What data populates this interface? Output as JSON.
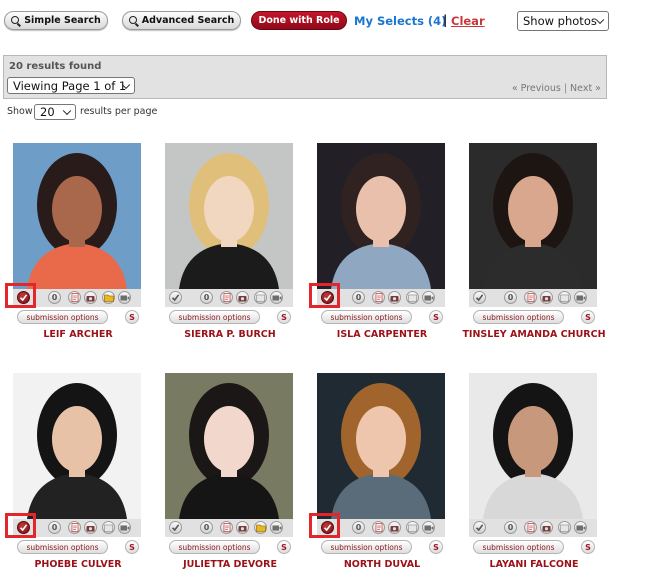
{
  "toolbar": {
    "simple_search": "Simple Search",
    "advanced_search": "Advanced Search",
    "done_with_role": "Done with Role",
    "my_selects": "My Selects (4)",
    "separator": "|",
    "clear": "Clear",
    "show_photos": "Show photos"
  },
  "results": {
    "found": "20 results found",
    "viewing": "Viewing Page 1 of 1",
    "previous": "« Previous",
    "pager_sep": "|",
    "next": "Next »",
    "show_label": "Show",
    "per_page": "20",
    "per_page_label": "results per page"
  },
  "card_labels": {
    "submission_options": "submission options",
    "s": "S",
    "info": "0"
  },
  "performers": [
    {
      "name": "LEIF ARCHER",
      "selected": true,
      "folder": true
    },
    {
      "name": "SIERRA P. BURCH",
      "selected": false,
      "folder": false
    },
    {
      "name": "ISLA CARPENTER",
      "selected": true,
      "folder": false
    },
    {
      "name": "TINSLEY AMANDA CHURCH",
      "selected": false,
      "folder": false
    },
    {
      "name": "PHOEBE CULVER",
      "selected": true,
      "folder": false
    },
    {
      "name": "JULIETTA DEVORE",
      "selected": false,
      "folder": true
    },
    {
      "name": "NORTH DUVAL",
      "selected": true,
      "folder": false
    },
    {
      "name": "LAYANI FALCONE",
      "selected": false,
      "folder": false
    }
  ],
  "colors": {
    "accent": "#9c1018",
    "link": "#1b76d0",
    "highlight": "#e3262b"
  }
}
